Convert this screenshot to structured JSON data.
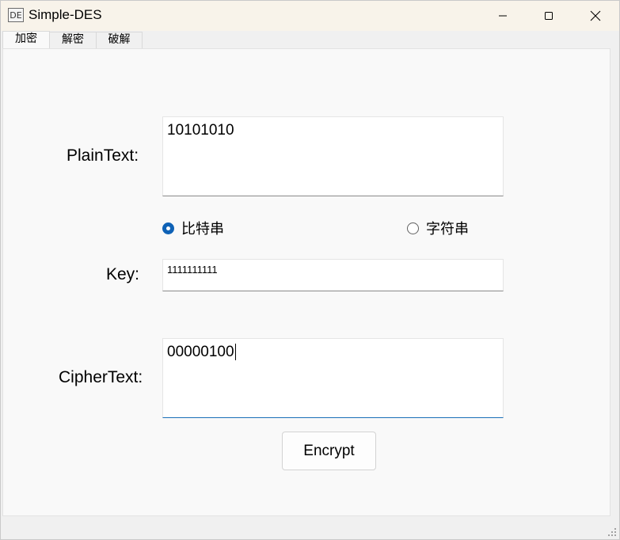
{
  "window": {
    "title": "Simple-DES",
    "icon_text": "DE"
  },
  "tabs": [
    {
      "label": "加密",
      "active": true
    },
    {
      "label": "解密",
      "active": false
    },
    {
      "label": "破解",
      "active": false
    }
  ],
  "form": {
    "plaintext_label": "PlainText:",
    "plaintext_value": "10101010",
    "mode_options": [
      {
        "label": "比特串",
        "selected": true
      },
      {
        "label": "字符串",
        "selected": false
      }
    ],
    "key_label": "Key:",
    "key_value": "1111111111",
    "ciphertext_label": "CipherText:",
    "ciphertext_value": "00000100",
    "encrypt_label": "Encrypt"
  },
  "colors": {
    "accent": "#0f62b6",
    "titlebar": "#f8f3ea"
  }
}
